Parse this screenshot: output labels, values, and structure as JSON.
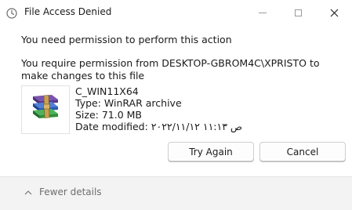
{
  "window": {
    "title": "File Access Denied",
    "title_icon": "clock-icon"
  },
  "dialog": {
    "headline": "You need permission to perform this action",
    "message": "You require permission from DESKTOP-GBROM4C\\XPRISTO to make changes to this file"
  },
  "file": {
    "icon": "winrar-archive-icon",
    "name": "C_WIN11X64",
    "type": "Type: WinRAR archive",
    "size": "Size: 71.0 MB",
    "date_modified": "Date modified: ۲۰۲۲/۱۱/۱۲ ص ۱۱:۱۳"
  },
  "buttons": {
    "try_again": "Try Again",
    "cancel": "Cancel"
  },
  "footer": {
    "fewer_details": "Fewer details"
  },
  "colors": {
    "footer_bg": "#f3f3f3",
    "winrar_purple": "#5b3a8c",
    "winrar_blue": "#2a5bb8",
    "winrar_green": "#2f8f3a",
    "strap_tan": "#c8a052"
  }
}
